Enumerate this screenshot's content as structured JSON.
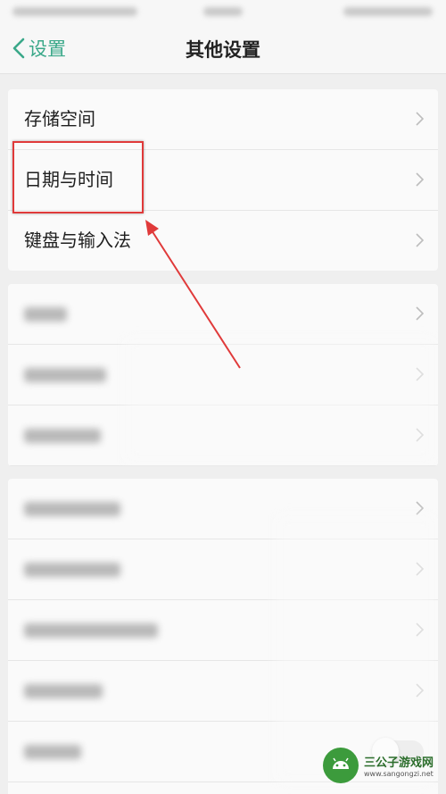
{
  "nav": {
    "back_label": "设置",
    "title": "其他设置"
  },
  "group1": {
    "items": [
      {
        "label": "存储空间"
      },
      {
        "label": "日期与时间"
      },
      {
        "label": "键盘与输入法"
      }
    ]
  },
  "watermark": {
    "name": "三公子游戏网",
    "url": "www.sangongzi.net"
  },
  "colors": {
    "accent": "#3aa889",
    "highlight": "#e03a3a"
  }
}
